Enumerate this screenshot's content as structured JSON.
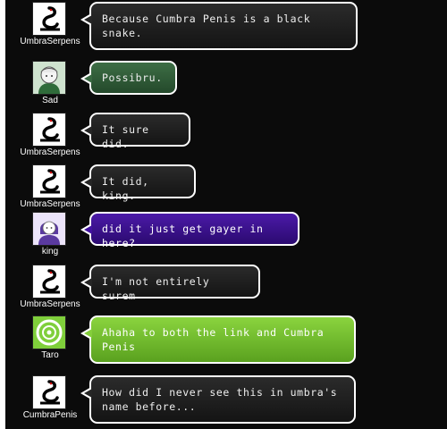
{
  "messages": [
    {
      "user": "UmbraSerpens",
      "avatar": "snake-avatar-icon",
      "text": "Because Cumbra Penis is a black snake.",
      "bubble_color": "#1f1f1f"
    },
    {
      "user": "Sad",
      "avatar": "sad-avatar-icon",
      "text": "Possibru.",
      "bubble_color": "#35603c"
    },
    {
      "user": "UmbraSerpens",
      "avatar": "snake-avatar-icon",
      "text": "It sure did.",
      "bubble_color": "#1f1f1f"
    },
    {
      "user": "UmbraSerpens",
      "avatar": "snake-avatar-icon",
      "text": "It did, king.",
      "bubble_color": "#1f1f1f"
    },
    {
      "user": "king",
      "avatar": "king-avatar-icon",
      "text": "did it just get gayer in here?",
      "bubble_color": "#3c1290"
    },
    {
      "user": "UmbraSerpens",
      "avatar": "snake-avatar-icon",
      "text": "I'm not entirely surem",
      "bubble_color": "#1f1f1f"
    },
    {
      "user": "Taro",
      "avatar": "taro-avatar-icon",
      "text": "Ahaha to both the link and Cumbra Penis",
      "bubble_color": "#72bb2e"
    },
    {
      "user": "CumbraPenis",
      "avatar": "snake-avatar-icon",
      "text": "How did I never see this in umbra's name before...",
      "bubble_color": "#1f1f1f"
    }
  ]
}
